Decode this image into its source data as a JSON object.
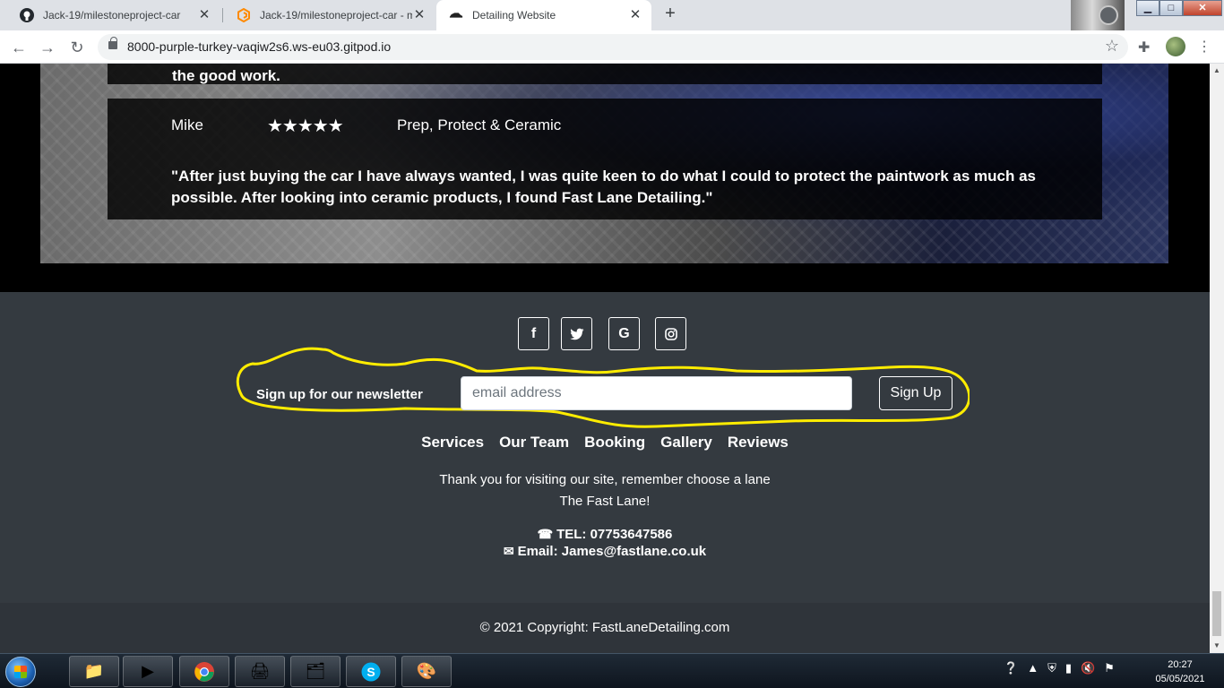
{
  "browser": {
    "tabs": [
      {
        "title": "Jack-19/milestoneproject-car",
        "icon": "github-icon"
      },
      {
        "title": "Jack-19/milestoneproject-car - m",
        "icon": "gitpod-icon"
      },
      {
        "title": "Detailing Website",
        "icon": "car-icon"
      }
    ],
    "new_tab": "+",
    "url": "8000-purple-turkey-vaqiw2s6.ws-eu03.gitpod.io",
    "window_buttons": {
      "minimize": "▁",
      "maximize": "□",
      "close": "✕"
    }
  },
  "reviews": {
    "previous_tail": "the good work.",
    "current": {
      "name": "Mike",
      "stars": "★★★★★",
      "service": "Prep, Protect & Ceramic",
      "text": "\"After just buying the car I have always wanted, I was quite keen to do what I could to protect the paintwork as much as possible. After looking into ceramic products, I found Fast Lane Detailing.\""
    }
  },
  "footer": {
    "social": [
      {
        "name": "facebook-icon",
        "glyph": "f"
      },
      {
        "name": "twitter-icon",
        "glyph": "🐦"
      },
      {
        "name": "google-icon",
        "glyph": "G"
      },
      {
        "name": "instagram-icon",
        "glyph": "◎"
      }
    ],
    "newsletter": {
      "label": "Sign up for our newsletter",
      "placeholder": "email address",
      "button": "Sign Up"
    },
    "nav": [
      "Services",
      "Our Team",
      "Booking",
      "Gallery",
      "Reviews"
    ],
    "thanks_line1": "Thank you for visiting our site, remember choose a lane",
    "thanks_line2": "The Fast Lane!",
    "tel": "TEL: 07753647586",
    "email": "Email: James@fastlane.co.uk",
    "copyright": "© 2021 Copyright: FastLaneDetailing.com",
    "annotation_color": "#ffec00"
  },
  "taskbar": {
    "apps": [
      "folder-icon",
      "media-player-icon",
      "chrome-icon",
      "hp-icon",
      "scanner-icon",
      "skype-icon",
      "paint-icon"
    ],
    "time": "20:27",
    "date": "05/05/2021"
  }
}
